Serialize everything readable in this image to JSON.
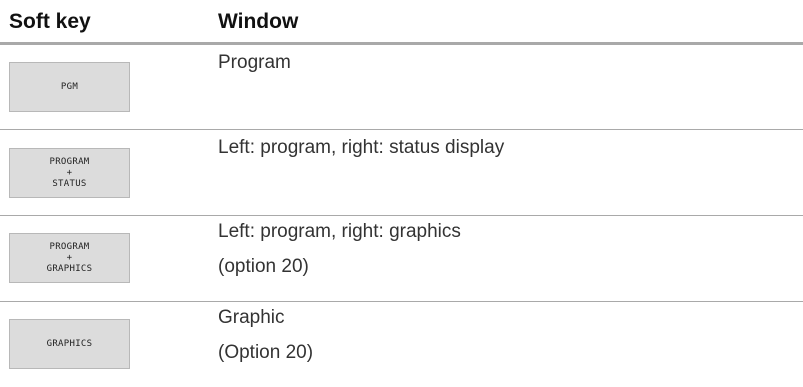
{
  "header": {
    "col_softkey": "Soft key",
    "col_window": "Window"
  },
  "rows": [
    {
      "softkey_lines": [
        "PGM"
      ],
      "window_lines": [
        "Program"
      ]
    },
    {
      "softkey_lines": [
        "PROGRAM",
        "+",
        "STATUS"
      ],
      "window_lines": [
        "Left: program, right: status display"
      ]
    },
    {
      "softkey_lines": [
        "PROGRAM",
        "+",
        "GRAPHICS"
      ],
      "window_lines": [
        "Left: program, right: graphics",
        "(option 20)"
      ]
    },
    {
      "softkey_lines": [
        "GRAPHICS"
      ],
      "window_lines": [
        "Graphic",
        "(Option 20)"
      ]
    }
  ]
}
